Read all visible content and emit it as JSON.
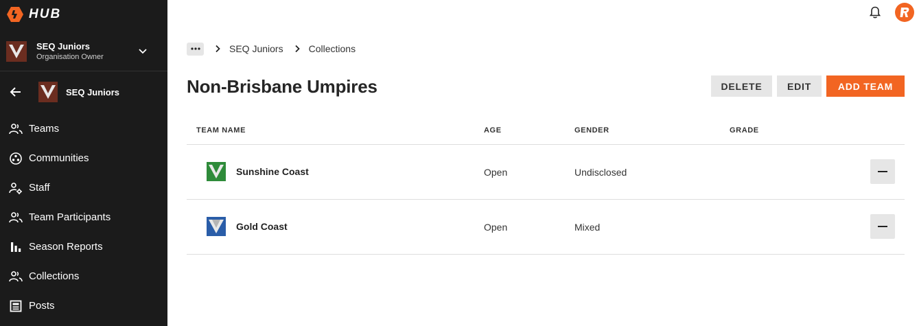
{
  "app": {
    "brand": "HUB"
  },
  "colors": {
    "accent": "#f26522",
    "sidebar_bg": "#1b1b1b"
  },
  "org_switcher": {
    "name": "SEQ Juniors",
    "role": "Organisation Owner"
  },
  "context": {
    "name": "SEQ Juniors"
  },
  "nav": {
    "items": [
      {
        "label": "Teams",
        "icon": "users-icon"
      },
      {
        "label": "Communities",
        "icon": "communities-icon"
      },
      {
        "label": "Staff",
        "icon": "staff-icon"
      },
      {
        "label": "Team Participants",
        "icon": "users-icon"
      },
      {
        "label": "Season Reports",
        "icon": "bar-chart-icon"
      },
      {
        "label": "Collections",
        "icon": "users-icon"
      },
      {
        "label": "Posts",
        "icon": "posts-icon"
      }
    ]
  },
  "topbar": {
    "avatar_initial": "R"
  },
  "breadcrumb": {
    "more": "•••",
    "items": [
      "SEQ Juniors",
      "Collections"
    ]
  },
  "page": {
    "title": "Non-Brisbane Umpires"
  },
  "actions": {
    "delete": "DELETE",
    "edit": "EDIT",
    "add_team": "ADD TEAM"
  },
  "table": {
    "headers": {
      "name": "TEAM NAME",
      "age": "AGE",
      "gender": "GENDER",
      "grade": "GRADE"
    },
    "rows": [
      {
        "name": "Sunshine Coast",
        "age": "Open",
        "gender": "Undisclosed",
        "grade": "",
        "logo_color": "#2e8b3a"
      },
      {
        "name": "Gold Coast",
        "age": "Open",
        "gender": "Mixed",
        "grade": "",
        "logo_color": "#2a5da8"
      }
    ]
  }
}
